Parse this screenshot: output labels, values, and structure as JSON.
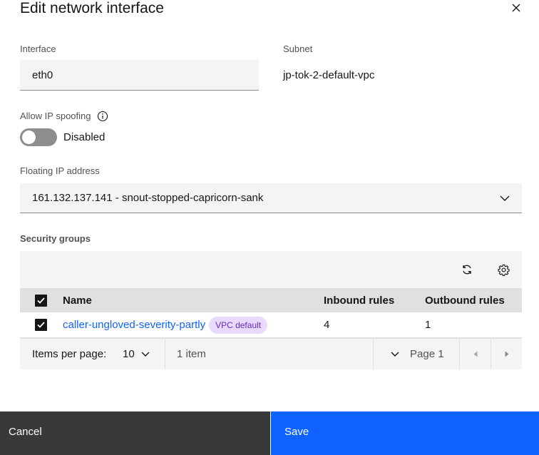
{
  "modal": {
    "title": "Edit network interface"
  },
  "interface": {
    "label": "Interface",
    "value": "eth0"
  },
  "subnet": {
    "label": "Subnet",
    "value": "jp-tok-2-default-vpc"
  },
  "ip_spoofing": {
    "label": "Allow IP spoofing",
    "state_text": "Disabled",
    "enabled": false
  },
  "floating_ip": {
    "label": "Floating IP address",
    "selected": "161.132.137.141 - snout-stopped-capricorn-sank"
  },
  "security_groups": {
    "label": "Security groups",
    "columns": [
      "Name",
      "Inbound rules",
      "Outbound rules"
    ],
    "rows": [
      {
        "name": "caller-ungloved-severity-partly",
        "tag": "VPC default",
        "inbound": "4",
        "outbound": "1",
        "selected": true
      }
    ],
    "pagination": {
      "items_per_page_label": "Items per page:",
      "items_per_page": "10",
      "item_count": "1 item",
      "page": "Page 1"
    }
  },
  "footer": {
    "cancel_label": "Cancel",
    "save_label": "Save"
  },
  "colors": {
    "primary": "#0f62fe",
    "secondary_button": "#393939",
    "tag_bg": "#e8daff",
    "tag_text": "#6929c4"
  },
  "icons": [
    "close-icon",
    "info-icon",
    "chevron-down-icon",
    "refresh-icon",
    "gear-icon",
    "checkmark-icon",
    "caret-left-icon",
    "caret-right-icon"
  ]
}
